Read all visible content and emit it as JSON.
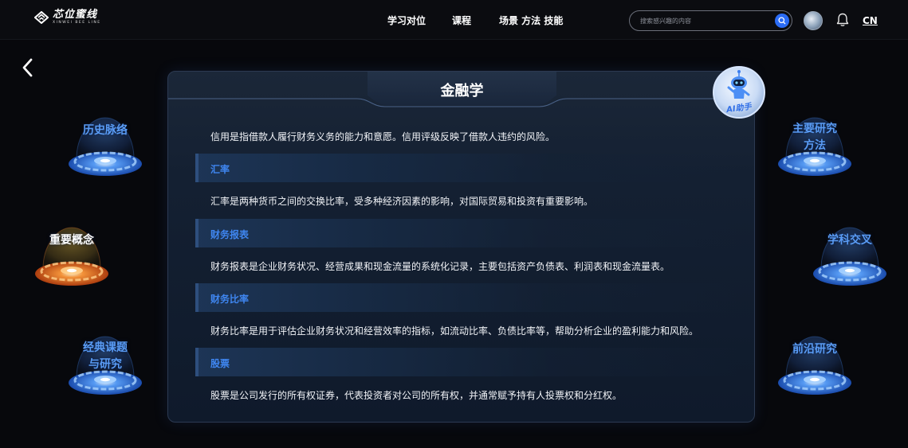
{
  "brand": {
    "name": "芯位蜜线",
    "tagline": "XINWEI BEE LINE"
  },
  "nav": {
    "items": [
      "学习对位",
      "课程",
      "场景 方法 技能"
    ]
  },
  "search": {
    "placeholder": "搜索感兴趣的内容"
  },
  "header": {
    "lang": "CN"
  },
  "card": {
    "title": "金融学",
    "intro": "信用是指借款人履行财务义务的能力和意愿。信用评级反映了借款人违约的风险。",
    "sections": [
      {
        "heading": "汇率",
        "text": "汇率是两种货币之间的交换比率，受多种经济因素的影响，对国际贸易和投资有重要影响。"
      },
      {
        "heading": "财务报表",
        "text": "财务报表是企业财务状况、经营成果和现金流量的系统化记录，主要包括资产负债表、利润表和现金流量表。"
      },
      {
        "heading": "财务比率",
        "text": "财务比率是用于评估企业财务状况和经营效率的指标，如流动比率、负债比率等，帮助分析企业的盈利能力和风险。"
      },
      {
        "heading": "股票",
        "text": "股票是公司发行的所有权证券，代表投资者对公司的所有权，并通常赋予持有人投票权和分红权。"
      }
    ]
  },
  "assistant": {
    "label": "AI助手"
  },
  "orbs": {
    "left": [
      {
        "l1": "历史脉络",
        "l2": ""
      },
      {
        "l1": "重要概念",
        "l2": ""
      },
      {
        "l1": "经典课题",
        "l2": "与研究"
      }
    ],
    "right": [
      {
        "l1": "主要研究",
        "l2": "方法"
      },
      {
        "l1": "学科交叉",
        "l2": ""
      },
      {
        "l1": "前沿研究",
        "l2": ""
      }
    ]
  },
  "colors": {
    "accent": "#2b6cf5",
    "section_text": "#3f86f0",
    "active_orb": "#e0651e",
    "orb_blue": "#2f6fd8"
  },
  "icons": [
    "chevron-left-icon",
    "search-icon",
    "bell-icon",
    "globe-avatar-icon",
    "robot-icon"
  ]
}
